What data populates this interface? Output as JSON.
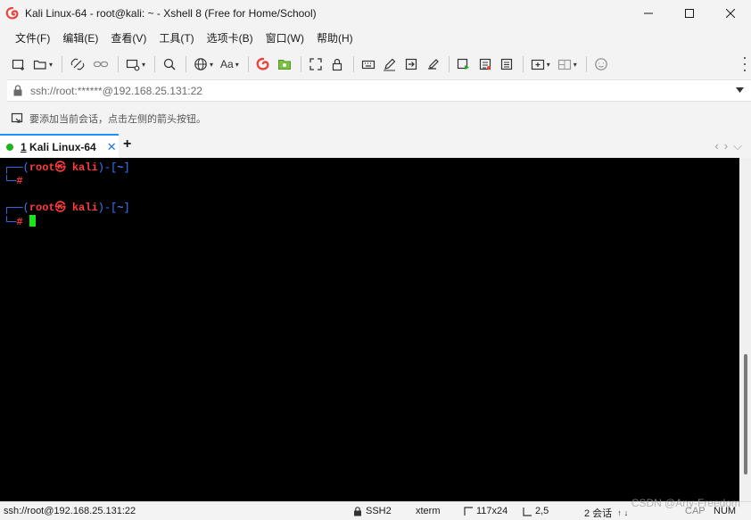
{
  "window": {
    "title": "Kali Linux-64 - root@kali: ~ - Xshell 8 (Free for Home/School)"
  },
  "menu": [
    {
      "label": "文件(F)"
    },
    {
      "label": "编辑(E)"
    },
    {
      "label": "查看(V)"
    },
    {
      "label": "工具(T)"
    },
    {
      "label": "选项卡(B)"
    },
    {
      "label": "窗口(W)"
    },
    {
      "label": "帮助(H)"
    }
  ],
  "toolbar": {
    "font_button_label": "Aa"
  },
  "address": {
    "value": "ssh://root:******@192.168.25.131:22"
  },
  "hint": {
    "text": "要添加当前会话，点击左侧的箭头按钮。"
  },
  "tabs": [
    {
      "number": "1",
      "label": "Kali Linux-64",
      "close": "✕"
    }
  ],
  "new_tab_label": "+",
  "terminal": {
    "prompt1": {
      "open": "┌──(",
      "user": "root",
      "at": "㉿",
      "host": "kali",
      "mid": ")-[",
      "path": "~",
      "close": "]",
      "tail": "└─",
      "hash": "#"
    },
    "prompt2": {
      "open": "┌──(",
      "user": "root",
      "at": "㉿",
      "host": "kali",
      "mid": ")-[",
      "path": "~",
      "close": "]",
      "tail": "└─",
      "hash": "#"
    }
  },
  "status": {
    "connection": "ssh://root@192.168.25.131:22",
    "protocol": "SSH2",
    "term": "xterm",
    "size": "117x24",
    "cursor_pos": "2,5",
    "sessions": "2 会话",
    "cap": "CAP",
    "num": "NUM"
  },
  "watermark": "CSDN @Any-Freedom",
  "colors": {
    "accent": "#1e90ff",
    "prompt_blue": "#3b7bff",
    "prompt_red": "#ff3b3b",
    "cursor_green": "#19e619"
  }
}
